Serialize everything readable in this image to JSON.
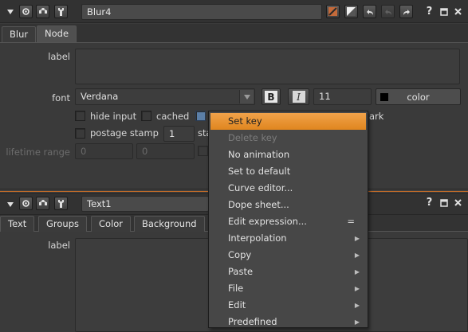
{
  "panel1": {
    "node_name": "Blur4",
    "tabs": [
      "Blur",
      "Node"
    ],
    "label_label": "label",
    "font_label": "font",
    "font_value": "Verdana",
    "bold_label": "B",
    "italic_label": "I",
    "font_size": "11",
    "color_label": "color",
    "hide_input_label": "hide input",
    "cached_label": "cached",
    "bookmark_fragment": "ark",
    "postage_stamp_label": "postage stamp",
    "postage_value": "1",
    "sta_fragment": "sta",
    "lifetime_label": "lifetime range",
    "lifetime_start": "0",
    "lifetime_end": "0"
  },
  "panel2": {
    "node_name": "Text1",
    "tabs": [
      "Text",
      "Groups",
      "Color",
      "Background"
    ],
    "label_label": "label"
  },
  "context_menu": {
    "items": [
      {
        "label": "Set key",
        "state": "highlighted"
      },
      {
        "label": "Delete key",
        "state": "disabled"
      },
      {
        "label": "No animation"
      },
      {
        "label": "Set to default"
      },
      {
        "label": "Curve editor..."
      },
      {
        "label": "Dope sheet..."
      },
      {
        "label": "Edit expression...",
        "shortcut": "="
      },
      {
        "label": "Interpolation",
        "submenu": true
      },
      {
        "label": "Copy",
        "submenu": true
      },
      {
        "label": "Paste",
        "submenu": true
      },
      {
        "label": "File",
        "submenu": true
      },
      {
        "label": "Edit",
        "submenu": true
      },
      {
        "label": "Predefined",
        "submenu": true
      }
    ]
  },
  "icons": [
    "collapse-triangle-icon",
    "circle-icon",
    "network-icon",
    "wrench-icon",
    "paint-icon",
    "slash-icon",
    "undo-icon",
    "redo-icon",
    "help-icon",
    "float-icon",
    "close-icon",
    "dropdown-arrow-icon",
    "submenu-arrow-icon"
  ],
  "colors": {
    "accent": "#e8901f",
    "divider": "#c06a28"
  }
}
